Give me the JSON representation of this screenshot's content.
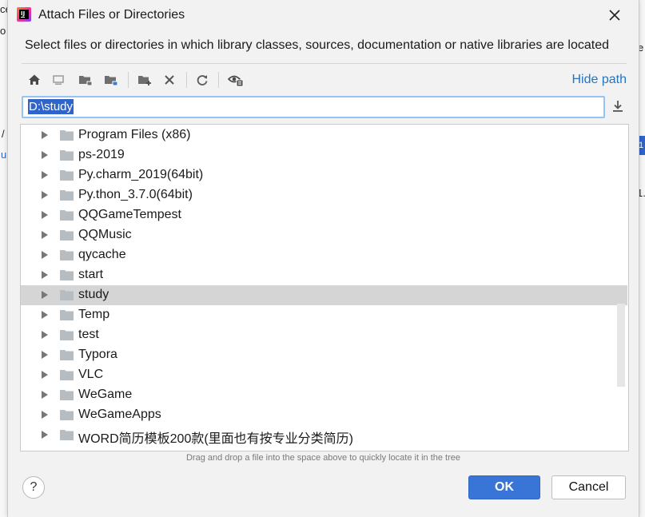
{
  "background": {
    "left_fragments": [
      "ce",
      "o",
      "/",
      "u"
    ],
    "right_fragments": [
      "e",
      "1."
    ],
    "right_badge": "1"
  },
  "dialog": {
    "title": "Attach Files or Directories",
    "description": "Select files or directories in which library classes, sources, documentation or native libraries are located"
  },
  "toolbar": {
    "icons": [
      "home-icon",
      "desktop-icon",
      "project-folder-icon",
      "module-folder-icon",
      "new-folder-icon",
      "delete-icon",
      "refresh-icon",
      "show-hidden-icon"
    ],
    "hide_path_label": "Hide path"
  },
  "path_field": {
    "value": "D:\\study"
  },
  "tree": {
    "items": [
      {
        "label": "Program Files (x86)",
        "selected": false
      },
      {
        "label": "ps-2019",
        "selected": false
      },
      {
        "label": "Py.charm_2019(64bit)",
        "selected": false
      },
      {
        "label": "Py.thon_3.7.0(64bit)",
        "selected": false
      },
      {
        "label": "QQGameTempest",
        "selected": false
      },
      {
        "label": "QQMusic",
        "selected": false
      },
      {
        "label": "qycache",
        "selected": false
      },
      {
        "label": "start",
        "selected": false
      },
      {
        "label": "study",
        "selected": true
      },
      {
        "label": "Temp",
        "selected": false
      },
      {
        "label": "test",
        "selected": false
      },
      {
        "label": "Typora",
        "selected": false
      },
      {
        "label": "VLC",
        "selected": false
      },
      {
        "label": "WeGame",
        "selected": false
      },
      {
        "label": "WeGameApps",
        "selected": false
      },
      {
        "label": "WORD简历模板200款(里面也有按专业分类简历)",
        "selected": false
      }
    ]
  },
  "hint": "Drag and drop a file into the space above to quickly locate it in the tree",
  "buttons": {
    "help": "?",
    "ok": "OK",
    "cancel": "Cancel"
  },
  "colors": {
    "accent": "#3875d7",
    "link": "#2675bf",
    "selection": "#2f65ca",
    "selected_row": "#d5d5d5",
    "folder": "#b5bcc2"
  }
}
